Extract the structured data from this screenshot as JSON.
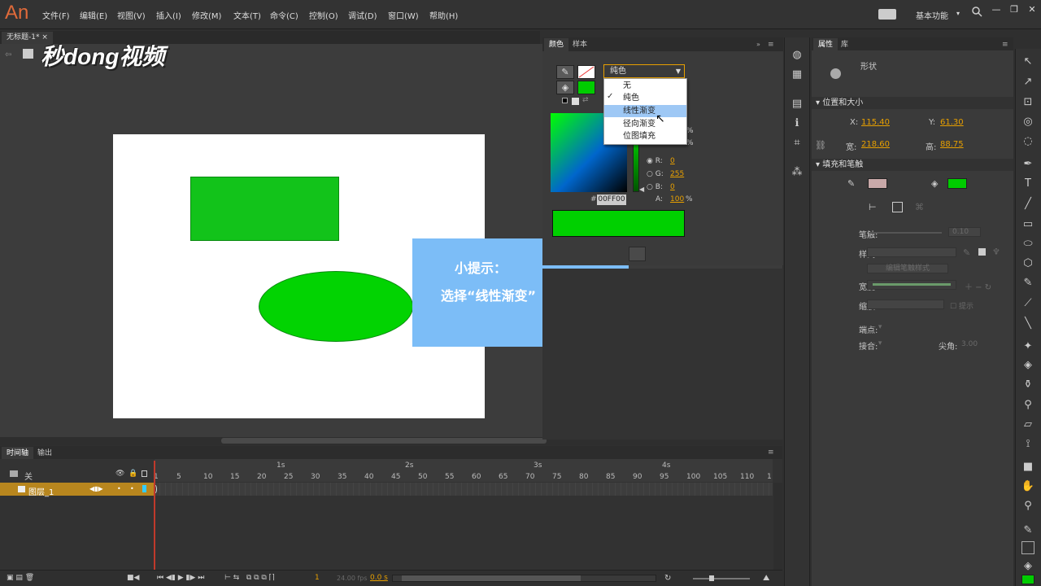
{
  "app": {
    "logo": "An",
    "workspace": "基本功能"
  },
  "menu": [
    "文件(F)",
    "编辑(E)",
    "视图(V)",
    "插入(I)",
    "修改(M)",
    "文本(T)",
    "命令(C)",
    "控制(O)",
    "调试(D)",
    "窗口(W)",
    "帮助(H)"
  ],
  "document": {
    "tab": "无标题-1*"
  },
  "watermark": "秒dong视频",
  "tip": {
    "title": "小提示：",
    "text": "选择“线性渐变”"
  },
  "color_panel": {
    "tabs": [
      "颜色",
      "样本"
    ],
    "fill_type": "纯色",
    "options": [
      "无",
      "纯色",
      "线性渐变",
      "径向渐变",
      "位图填充"
    ],
    "selected_option": "纯色",
    "highlighted_option": "线性渐变",
    "r_label": "R:",
    "r": "0",
    "g_label": "G:",
    "g": "255",
    "b_label": "B:",
    "b": "0",
    "a_label": "A:",
    "alpha": "100",
    "percent": "%",
    "hex_label": "#",
    "hex": "00FF00",
    "fill_color": "#00ff00"
  },
  "properties": {
    "tabs": [
      "属性",
      "库"
    ],
    "object": "形状",
    "section_position": "位置和大小",
    "x_label": "X:",
    "x": "115.40",
    "y_label": "Y:",
    "y": "61.30",
    "w_label": "宽:",
    "w": "218.60",
    "h_label": "高:",
    "h": "88.75",
    "section_fill": "填充和笔触",
    "stroke_label": "笔触:",
    "stroke_value": "0.10",
    "style_label": "样式:",
    "edit_style": "编辑笔触样式",
    "width_label": "宽度:",
    "scale_label": "缩放:",
    "hint_label": "提示",
    "cap_label": "端点:",
    "join_label": "接合:",
    "miter_label": "尖角:",
    "miter_value": "3.00"
  },
  "timeline": {
    "tabs": [
      "时间轴",
      "输出"
    ],
    "folder_label": "关",
    "layer": "图层_1",
    "frame_numbers": [
      "1",
      "5",
      "10",
      "15",
      "20",
      "25",
      "30",
      "35",
      "40",
      "45",
      "50",
      "55",
      "60",
      "65",
      "70",
      "75",
      "80",
      "85",
      "90",
      "95",
      "100",
      "105",
      "110",
      "1"
    ],
    "seconds": [
      "1s",
      "2s",
      "3s",
      "4s"
    ],
    "current_frame": "1",
    "fps": "24.00 fps",
    "time": "0.0 s"
  }
}
